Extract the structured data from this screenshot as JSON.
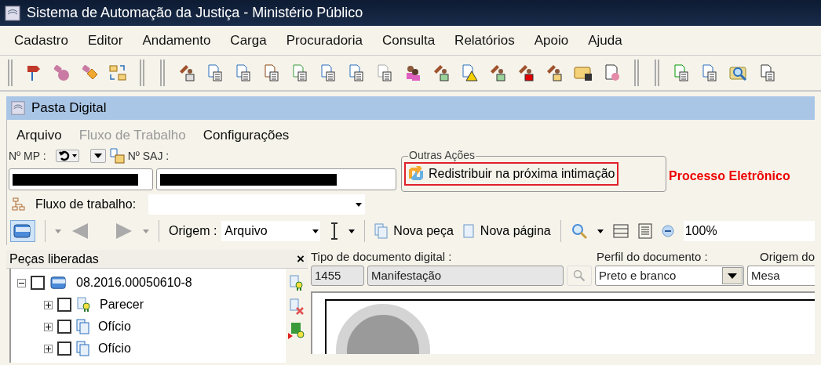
{
  "window": {
    "title": "Sistema de Automação da Justiça - Ministério Público"
  },
  "menu": [
    "Cadastro",
    "Editor",
    "Andamento",
    "Carga",
    "Procuradoria",
    "Consulta",
    "Relatórios",
    "Apoio",
    "Ajuda"
  ],
  "subwindow": {
    "title": "Pasta Digital",
    "menu": [
      {
        "label": "Arquivo",
        "disabled": false
      },
      {
        "label": "Fluxo de Trabalho",
        "disabled": true
      },
      {
        "label": "Configurações",
        "disabled": false
      }
    ],
    "mp_label": "Nº MP :",
    "saj_label": "Nº SAJ :",
    "other_actions": {
      "legend": "Outras Ações",
      "button": "Redistribuir na próxima intimação"
    },
    "status_text": "Processo Eletrônico",
    "workflow_label": "Fluxo de trabalho:",
    "origin_label": "Origem :",
    "origin_value": "Arquivo",
    "new_piece": "Nova peça",
    "new_page": "Nova página",
    "zoom_value": "100%",
    "tree": {
      "title": "Peças liberadas",
      "close": "×",
      "items": [
        {
          "label": "08.2016.00050610-8",
          "expanded": true,
          "checked": false,
          "children": [
            {
              "label": "Parecer",
              "expanded": false,
              "checked": false
            },
            {
              "label": "Ofício",
              "expanded": false,
              "checked": false
            },
            {
              "label": "Ofício",
              "expanded": false,
              "checked": false
            }
          ]
        }
      ]
    },
    "document": {
      "type_label": "Tipo de documento digital :",
      "type_code": "1455",
      "type_name": "Manifestação",
      "profile_label": "Perfil do documento :",
      "profile_value": "Preto e branco",
      "origin_label": "Origem do",
      "origin_value": "Mesa"
    }
  }
}
